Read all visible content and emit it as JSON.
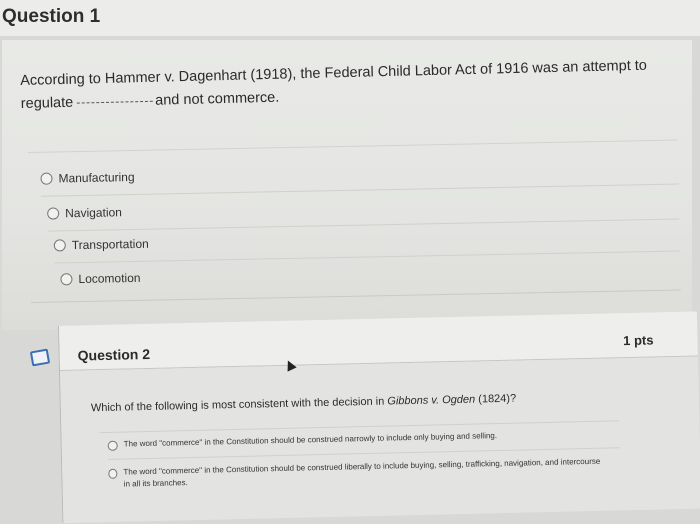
{
  "question1": {
    "title": "Question 1",
    "text_before": "According to Hammer v. Dagenhart (1918), the Federal Child Labor Act of 1916 was an attempt to",
    "text_line2_start": "regulate",
    "text_after": "and not commerce.",
    "options": [
      "Manufacturing",
      "Navigation",
      "Transportation",
      "Locomotion"
    ]
  },
  "question2": {
    "title": "Question 2",
    "points": "1 pts",
    "text_pre": "Which of the following is most consistent with the decision in ",
    "text_case": "Gibbons v. Ogden",
    "text_post": " (1824)?",
    "options": [
      "The word \"commerce\" in the Constitution should be construed narrowly to include only buying and selling.",
      "The word \"commerce\" in the Constitution should be construed liberally to include buying, selling, trafficking, navigation, and intercourse in all its branches."
    ]
  },
  "icons": {
    "flag": "bookmark-flag-icon",
    "cursor": "mouse-cursor-icon"
  },
  "colors": {
    "flag_border": "#3b6fb0",
    "background": "#d8d9d6"
  }
}
